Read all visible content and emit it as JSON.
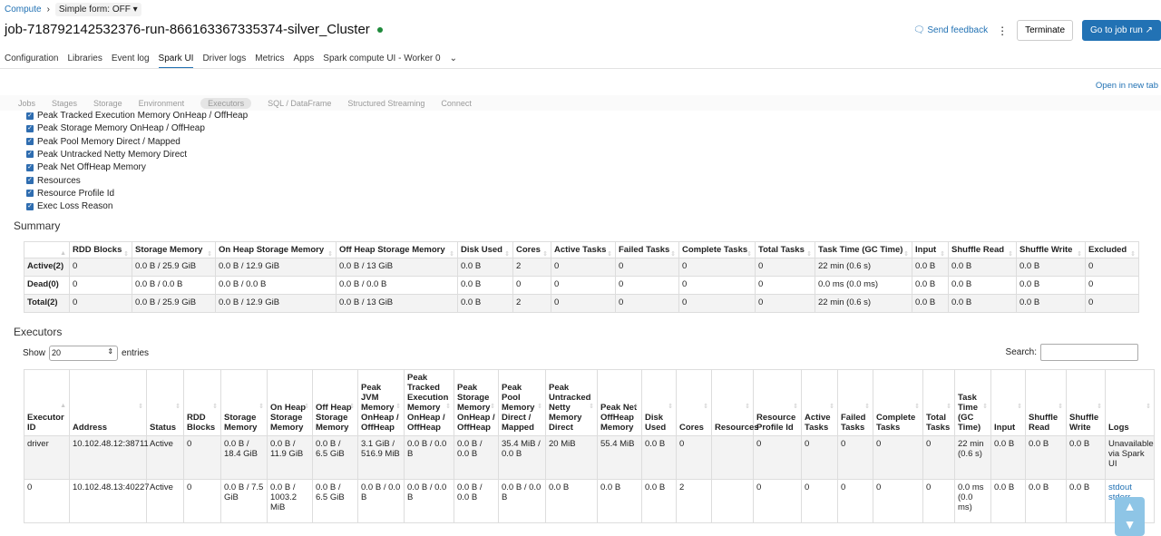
{
  "breadcrumb": {
    "compute": "Compute",
    "simple_form": "Simple form: OFF"
  },
  "header": {
    "title": "job-718792142532376-run-866163367335374-silver_Cluster",
    "feedback": "Send feedback",
    "terminate": "Terminate",
    "go_to_job": "Go to job run",
    "status_color": "#1f8a3b"
  },
  "tabs": [
    "Configuration",
    "Libraries",
    "Event log",
    "Spark UI",
    "Driver logs",
    "Metrics",
    "Apps",
    "Spark compute UI - Worker 0"
  ],
  "open_new_tab": "Open in new tab",
  "spark_tabs": [
    "Jobs",
    "Stages",
    "Storage",
    "Environment",
    "Executors",
    "SQL / DataFrame",
    "Structured Streaming",
    "Connect"
  ],
  "checkboxes": [
    "Peak Tracked Execution Memory OnHeap / OffHeap",
    "Peak Storage Memory OnHeap / OffHeap",
    "Peak Pool Memory Direct / Mapped",
    "Peak Untracked Netty Memory Direct",
    "Peak Net OffHeap Memory",
    "Resources",
    "Resource Profile Id",
    "Exec Loss Reason"
  ],
  "summary": {
    "title": "Summary",
    "headers": [
      "",
      "RDD Blocks",
      "Storage Memory",
      "On Heap Storage Memory",
      "Off Heap Storage Memory",
      "Disk Used",
      "Cores",
      "Active Tasks",
      "Failed Tasks",
      "Complete Tasks",
      "Total Tasks",
      "Task Time (GC Time)",
      "Input",
      "Shuffle Read",
      "Shuffle Write",
      "Excluded"
    ],
    "rows": [
      [
        "Active(2)",
        "0",
        "0.0 B / 25.9 GiB",
        "0.0 B / 12.9 GiB",
        "0.0 B / 13 GiB",
        "0.0 B",
        "2",
        "0",
        "0",
        "0",
        "0",
        "22 min (0.6 s)",
        "0.0 B",
        "0.0 B",
        "0.0 B",
        "0"
      ],
      [
        "Dead(0)",
        "0",
        "0.0 B / 0.0 B",
        "0.0 B / 0.0 B",
        "0.0 B / 0.0 B",
        "0.0 B",
        "0",
        "0",
        "0",
        "0",
        "0",
        "0.0 ms (0.0 ms)",
        "0.0 B",
        "0.0 B",
        "0.0 B",
        "0"
      ],
      [
        "Total(2)",
        "0",
        "0.0 B / 25.9 GiB",
        "0.0 B / 12.9 GiB",
        "0.0 B / 13 GiB",
        "0.0 B",
        "2",
        "0",
        "0",
        "0",
        "0",
        "22 min (0.6 s)",
        "0.0 B",
        "0.0 B",
        "0.0 B",
        "0"
      ]
    ]
  },
  "executors": {
    "title": "Executors",
    "show": "Show",
    "entries_value": "20",
    "entries": "entries",
    "search": "Search:",
    "headers": [
      "Executor ID",
      "Address",
      "Status",
      "RDD Blocks",
      "Storage Memory",
      "On Heap Storage Memory",
      "Off Heap Storage Memory",
      "Peak JVM Memory OnHeap / OffHeap",
      "Peak Tracked Execution Memory OnHeap / OffHeap",
      "Peak Storage Memory OnHeap / OffHeap",
      "Peak Pool Memory Direct / Mapped",
      "Peak Untracked Netty Memory Direct",
      "Peak Net OffHeap Memory",
      "Disk Used",
      "Cores",
      "Resources",
      "Resource Profile Id",
      "Active Tasks",
      "Failed Tasks",
      "Complete Tasks",
      "Total Tasks",
      "Task Time (GC Time)",
      "Input",
      "Shuffle Read",
      "Shuffle Write",
      "Logs"
    ],
    "rows": [
      [
        "driver",
        "10.102.48.12:38711",
        "Active",
        "0",
        "0.0 B / 18.4 GiB",
        "0.0 B / 11.9 GiB",
        "0.0 B / 6.5 GiB",
        "3.1 GiB / 516.9 MiB",
        "0.0 B / 0.0 B",
        "0.0 B / 0.0 B",
        "35.4 MiB / 0.0 B",
        "20 MiB",
        "55.4 MiB",
        "0.0 B",
        "0",
        "",
        "0",
        "0",
        "0",
        "0",
        "0",
        "22 min (0.6 s)",
        "0.0 B",
        "0.0 B",
        "0.0 B",
        "Unavailable via Spark UI"
      ],
      [
        "0",
        "10.102.48.13:40227",
        "Active",
        "0",
        "0.0 B / 7.5 GiB",
        "0.0 B / 1003.2 MiB",
        "0.0 B / 6.5 GiB",
        "0.0 B / 0.0 B",
        "0.0 B / 0.0 B",
        "0.0 B / 0.0 B",
        "0.0 B / 0.0 B",
        "0.0 B",
        "0.0 B",
        "0.0 B",
        "2",
        "",
        "0",
        "0",
        "0",
        "0",
        "0",
        "0.0 ms (0.0 ms)",
        "0.0 B",
        "0.0 B",
        "0.0 B",
        ""
      ]
    ],
    "logs_links": [
      "stdout",
      "stderr"
    ]
  }
}
